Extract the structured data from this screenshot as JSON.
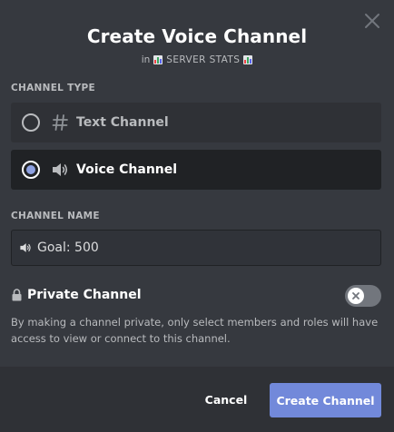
{
  "modal": {
    "title": "Create Voice Channel",
    "subtitle_prefix": "in",
    "server_name": "SERVER STATS"
  },
  "channel_type": {
    "label": "Channel Type",
    "options": [
      {
        "label": "Text Channel",
        "icon": "hash-icon",
        "selected": false
      },
      {
        "label": "Voice Channel",
        "icon": "speaker-icon",
        "selected": true
      }
    ]
  },
  "channel_name": {
    "label": "Channel Name",
    "value": "Goal: 500",
    "icon": "speaker-icon"
  },
  "private": {
    "label": "Private Channel",
    "enabled": false,
    "description": "By making a channel private, only select members and roles will have access to view or connect to this channel."
  },
  "footer": {
    "cancel_label": "Cancel",
    "create_label": "Create Channel"
  },
  "colors": {
    "background": "#36393f",
    "footer": "#2f3136",
    "accent": "#7289da",
    "selected_option": "#202225"
  }
}
